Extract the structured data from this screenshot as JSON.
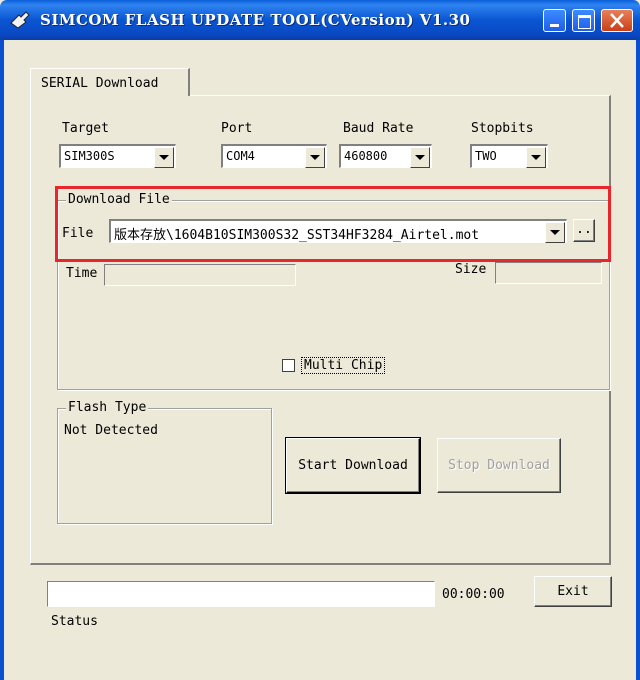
{
  "window": {
    "title": "SIMCOM FLASH UPDATE TOOL(CVersion) V1.30"
  },
  "tabs": [
    {
      "label": "SERIAL Download"
    }
  ],
  "settings": {
    "target": {
      "label": "Target",
      "value": "SIM300S"
    },
    "port": {
      "label": "Port",
      "value": "COM4"
    },
    "baud_rate": {
      "label": "Baud Rate",
      "value": "460800"
    },
    "stopbits": {
      "label": "Stopbits",
      "value": "TWO"
    }
  },
  "download_file": {
    "group_label": "Download File",
    "file_label": "File",
    "file_value": "版本存放\\1604B10SIM300S32_SST34HF3284_Airtel.mot",
    "browse_label": ".."
  },
  "info": {
    "time_label": "Time",
    "size_label": "Size",
    "multi_chip_label": "Multi Chip",
    "multi_chip_checked": false
  },
  "flash_type": {
    "group_label": "Flash Type",
    "value": "Not Detected"
  },
  "buttons": {
    "start_download": "Start Download",
    "stop_download": "Stop Download",
    "exit": "Exit"
  },
  "status": {
    "elapsed": "00:00:00",
    "label": "Status",
    "progress": 0
  },
  "colors": {
    "titlebar": "#0a55d2",
    "highlight": "#e8262c",
    "window_bg": "#ece9d8"
  }
}
